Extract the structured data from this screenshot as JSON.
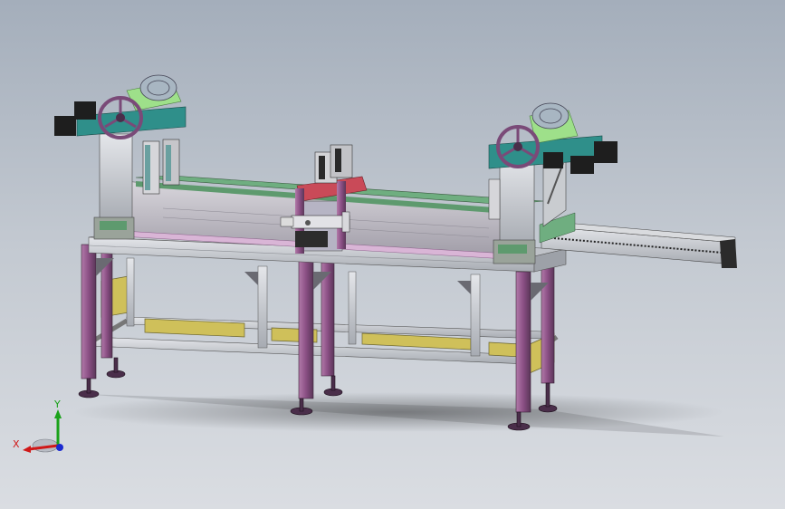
{
  "scene": {
    "type": "cad-assembly-isometric",
    "colors": {
      "background_top": "#a4aebb",
      "background_bottom": "#dadde2",
      "frame_purple": "#9a5e92",
      "frame_dark": "#5a3658",
      "aluminum": "#c9ccd0",
      "teal": "#2f8f8a",
      "lime": "#9ee08a",
      "handwheel": "#7a4a78",
      "motor_dark": "#1e1e1e",
      "carriage_red": "#c94a58",
      "rail_green": "#5e9a6e",
      "bracket_yellow": "#cfc05a"
    }
  },
  "triad": {
    "x_label": "X",
    "y_label": "Y",
    "x_color": "#d01818",
    "y_color": "#1aa21a",
    "z_color": "#1a2ad0"
  }
}
